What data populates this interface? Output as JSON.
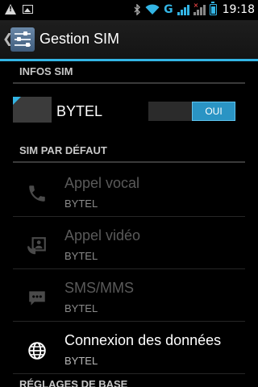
{
  "status_bar": {
    "time": "19:18",
    "network_type": "G",
    "icons": [
      "warning-icon",
      "image-icon",
      "bluetooth-icon",
      "wifi-icon",
      "signal-icon",
      "no-signal-icon",
      "battery-icon"
    ]
  },
  "action_bar": {
    "title": "Gestion SIM",
    "icon": "sim-settings-icon",
    "up_icon": "chevron-left-icon"
  },
  "sections": {
    "sim_info": {
      "header": "INFOS SIM"
    },
    "default_sim": {
      "header": "SIM PAR DÉFAUT"
    },
    "basic_settings": {
      "header": "RÉGLAGES DE BASE"
    }
  },
  "sim": {
    "name": "BYTEL",
    "toggle_label": "OUI",
    "enabled": true
  },
  "default_items": [
    {
      "title": "Appel vocal",
      "subtitle": "BYTEL",
      "icon": "phone-icon",
      "enabled": false
    },
    {
      "title": "Appel vidéo",
      "subtitle": "BYTEL",
      "icon": "video-call-icon",
      "enabled": false
    },
    {
      "title": "SMS/MMS",
      "subtitle": "BYTEL",
      "icon": "message-icon",
      "enabled": false
    },
    {
      "title": "Connexion des données",
      "subtitle": "BYTEL",
      "icon": "globe-icon",
      "enabled": true
    }
  ],
  "colors": {
    "accent": "#33b5e5",
    "background": "#000000",
    "disabled_text": "#5a5a5a"
  }
}
